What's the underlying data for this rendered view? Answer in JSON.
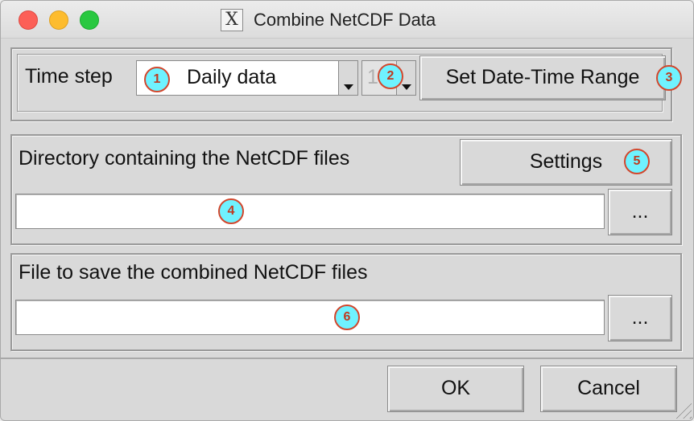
{
  "window": {
    "title": "Combine NetCDF Data",
    "app_icon": "X"
  },
  "timestep": {
    "label": "Time step",
    "selected": "Daily data",
    "spin_value": "1",
    "range_button": "Set Date-Time Range"
  },
  "directory": {
    "label": "Directory containing the NetCDF files",
    "settings_button": "Settings",
    "value": "",
    "browse_button": "..."
  },
  "output": {
    "label": "File to save the combined NetCDF files",
    "value": "",
    "browse_button": "..."
  },
  "footer": {
    "ok_button": "OK",
    "cancel_button": "Cancel"
  },
  "markers": [
    "1",
    "2",
    "3",
    "4",
    "5",
    "6"
  ],
  "colors": {
    "marker_fill": "#6ff2ff",
    "marker_border": "#d2462c"
  }
}
